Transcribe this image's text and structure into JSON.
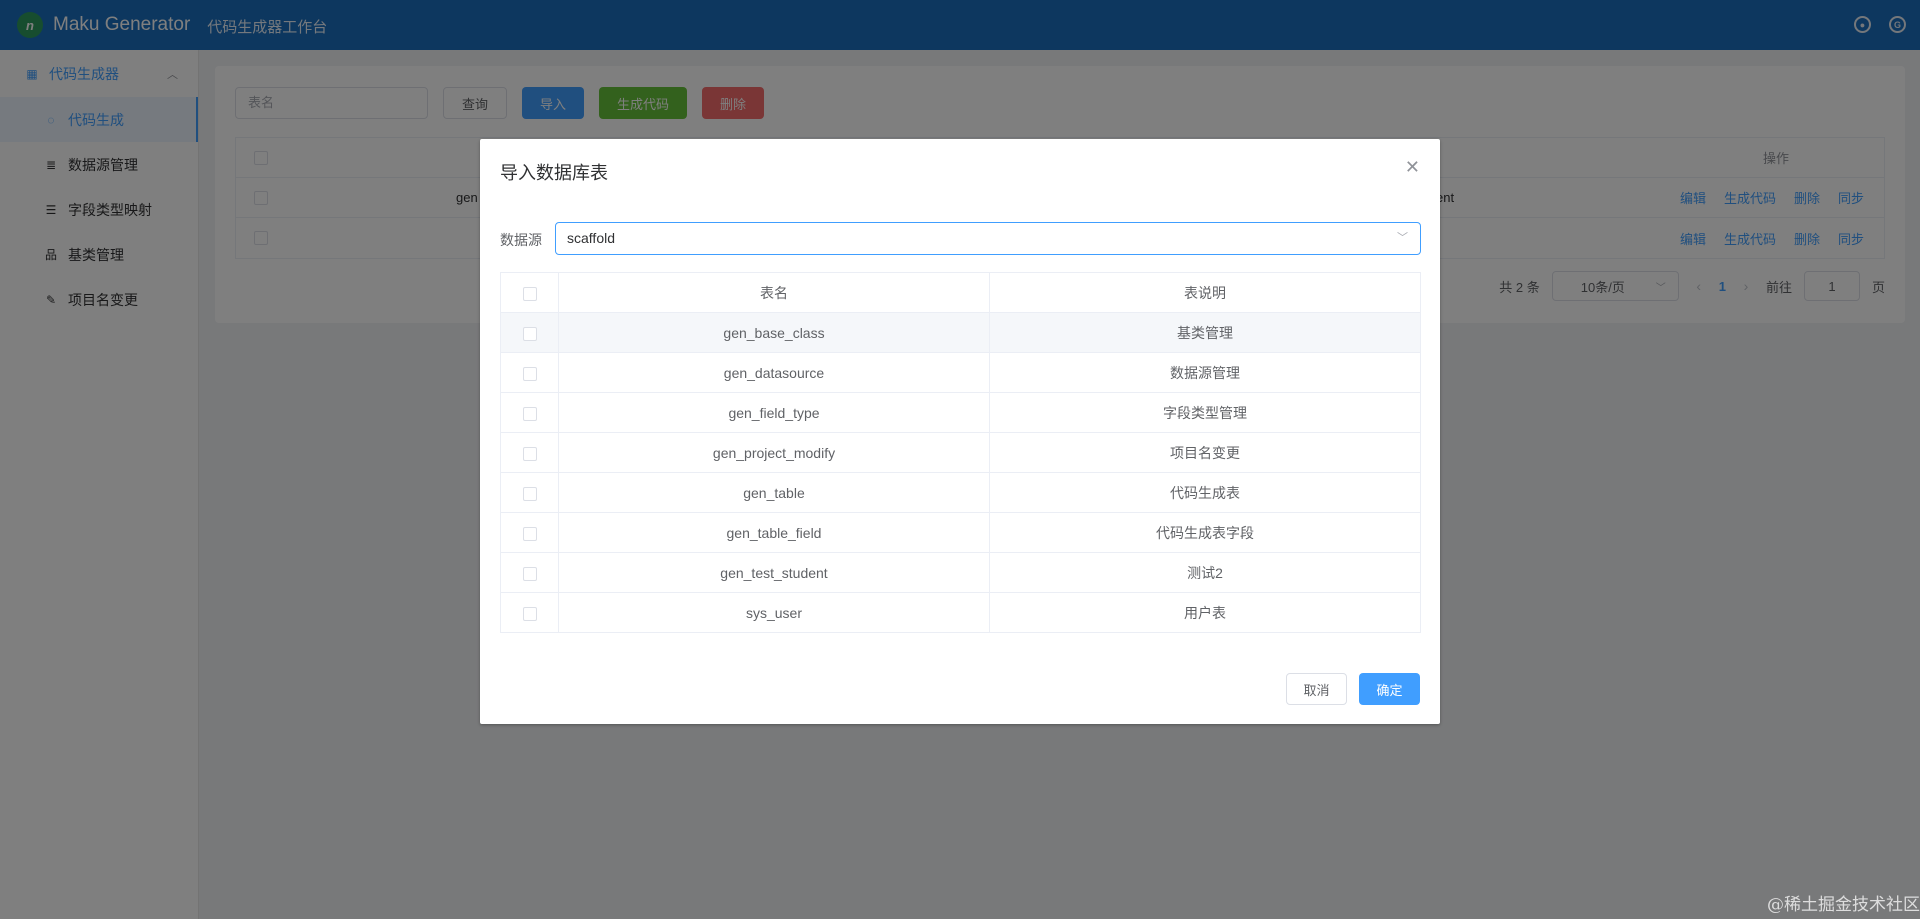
{
  "header": {
    "brand": "Maku Generator",
    "subtitle": "代码生成器工作台",
    "icons": [
      "github-icon",
      "gitee-icon"
    ]
  },
  "sidebar": {
    "group_label": "代码生成器",
    "items": [
      {
        "label": "代码生成",
        "icon": "drop-icon",
        "active": true
      },
      {
        "label": "数据源管理",
        "icon": "database-icon"
      },
      {
        "label": "字段类型映射",
        "icon": "list-icon"
      },
      {
        "label": "基类管理",
        "icon": "tree-icon"
      },
      {
        "label": "项目名变更",
        "icon": "edit-icon"
      }
    ]
  },
  "toolbar": {
    "search_placeholder": "表名",
    "query_label": "查询",
    "import_label": "导入",
    "generate_label": "生成代码",
    "delete_label": "删除"
  },
  "bg_table": {
    "ops_header": "操作",
    "row1_left": "gen",
    "row1_right": "ent",
    "ops": [
      "编辑",
      "生成代码",
      "删除",
      "同步"
    ]
  },
  "pager": {
    "total": "共 2 条",
    "page_size": "10条/页",
    "current_page": "1",
    "goto_label": "前往",
    "goto_value": "1",
    "page_suffix": "页"
  },
  "dialog": {
    "title": "导入数据库表",
    "datasource_label": "数据源",
    "datasource_value": "scaffold",
    "col_name": "表名",
    "col_comment": "表说明",
    "rows": [
      {
        "name": "gen_base_class",
        "comment": "基类管理"
      },
      {
        "name": "gen_datasource",
        "comment": "数据源管理"
      },
      {
        "name": "gen_field_type",
        "comment": "字段类型管理"
      },
      {
        "name": "gen_project_modify",
        "comment": "项目名变更"
      },
      {
        "name": "gen_table",
        "comment": "代码生成表"
      },
      {
        "name": "gen_table_field",
        "comment": "代码生成表字段"
      },
      {
        "name": "gen_test_student",
        "comment": "测试2"
      },
      {
        "name": "sys_user",
        "comment": "用户表"
      }
    ],
    "cancel_label": "取消",
    "ok_label": "确定"
  },
  "watermark": "@稀土掘金技术社区"
}
